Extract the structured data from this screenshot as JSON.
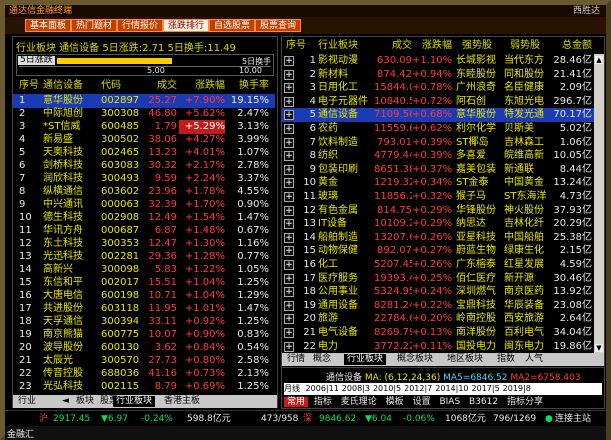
{
  "title_bar": {
    "left": "通达信金融终端",
    "right": "西胜达"
  },
  "toolbar": {
    "tabs": [
      "基本面板",
      "热门题材",
      "行情报价",
      "涨跌排行",
      "自选股票",
      "股票查询"
    ],
    "active": 3
  },
  "left_header": {
    "line": "行业板块  通信设备  5日涨跌:2.71  5日换手:11.49",
    "tab": "5日涨跌",
    "axis_left": "5.00",
    "axis_right": "10.00",
    "note": "5日换手"
  },
  "left_table": {
    "columns": [
      "序号",
      "通信设备",
      "代码",
      "成交",
      "涨跌幅",
      "换手率"
    ],
    "rows": [
      [
        "1",
        "意华股份",
        "002897",
        "25.27",
        "+7.90%",
        "19.15%"
      ],
      [
        "2",
        "中际旭创",
        "300308",
        "46.80",
        "+5.62%",
        "2.47%"
      ],
      [
        "3",
        "*ST信威",
        "600485",
        "1.79",
        "+5.29%",
        "3.13%"
      ],
      [
        "4",
        "新易盛",
        "300502",
        "38.06",
        "+4.27%",
        "3.99%"
      ],
      [
        "5",
        "天奥科技",
        "002465",
        "13.23",
        "+4.01%",
        "1.07%"
      ],
      [
        "6",
        "剑桥科技",
        "603083",
        "30.32",
        "+2.17%",
        "2.78%"
      ],
      [
        "7",
        "润欣科技",
        "300493",
        "9.59",
        "+2.24%",
        "3.37%"
      ],
      [
        "8",
        "纵横通信",
        "603602",
        "23.96",
        "+1.78%",
        "4.55%"
      ],
      [
        "9",
        "中兴通讯",
        "000063",
        "32.39",
        "+1.70%",
        "0.90%"
      ],
      [
        "10",
        "德生科技",
        "002908",
        "12.49",
        "+1.54%",
        "1.47%"
      ],
      [
        "11",
        "华讯方舟",
        "000687",
        "6.87",
        "+1.48%",
        "0.67%"
      ],
      [
        "12",
        "东土科技",
        "300353",
        "12.47",
        "+1.30%",
        "1.16%"
      ],
      [
        "13",
        "光迅科技",
        "002281",
        "29.36",
        "+1.28%",
        "0.77%"
      ],
      [
        "14",
        "高新兴",
        "300098",
        "5.83",
        "+1.22%",
        "1.05%"
      ],
      [
        "15",
        "东信和平",
        "002017",
        "15.51",
        "+1.04%",
        "1.25%"
      ],
      [
        "16",
        "大唐电信",
        "600198",
        "10.71",
        "+1.04%",
        "1.29%"
      ],
      [
        "17",
        "共进股份",
        "603118",
        "11.95",
        "+1.01%",
        "1.47%"
      ],
      [
        "18",
        "天孚通信",
        "300394",
        "33.11",
        "+0.92%",
        "1.25%"
      ],
      [
        "19",
        "南京熊猫",
        "600775",
        "10.07",
        "+0.90%",
        "0.83%"
      ],
      [
        "20",
        "波导股份",
        "600130",
        "3.62",
        "+0.84%",
        "0.54%"
      ],
      [
        "21",
        "太辰光",
        "300570",
        "27.73",
        "+0.80%",
        "2.58%"
      ],
      [
        "22",
        "传音控股",
        "688036",
        "41.16",
        "+0.73%",
        "2.13%"
      ],
      [
        "23",
        "光弘科技",
        "002115",
        "8.79",
        "+0.69%",
        "1.25%"
      ]
    ]
  },
  "left_tabs": [
    "行业",
    "板块",
    "股票",
    "行业板块",
    "香港主板"
  ],
  "left_tabs_active": 3,
  "right_table": {
    "columns": [
      "序号",
      "行业板块",
      "成交",
      "涨跌幅",
      "强势股",
      "弱势股",
      "总金额"
    ],
    "rows": [
      [
        "1",
        "影视动漫",
        "630.09",
        "+1.10%",
        "长城影视",
        "当代东方",
        "28.46亿"
      ],
      [
        "2",
        "新材料",
        "874.42",
        "+0.94%",
        "东睦股份",
        "同和股份",
        "21.41亿"
      ],
      [
        "3",
        "日用化工",
        "15844.07",
        "+0.78%",
        "广州浪奇",
        "名臣健康",
        "2.09亿"
      ],
      [
        "4",
        "电子元器件",
        "10840.54",
        "+0.72%",
        "阿石创",
        "东旭光电",
        "296.7亿"
      ],
      [
        "5",
        "通信设备",
        "7109.56",
        "+0.68%",
        "意华股份",
        "特发光通",
        "70.17亿"
      ],
      [
        "6",
        "农药",
        "11559.61",
        "+0.62%",
        "利尔化学",
        "贝斯美",
        "5.02亿"
      ],
      [
        "7",
        "饮料制造",
        "793.01",
        "+0.39%",
        "ST椰岛",
        "吉林森工",
        "1.06亿"
      ],
      [
        "8",
        "纺织",
        "4779.44",
        "+0.39%",
        "多喜爱",
        "皖维高新",
        "10.05亿"
      ],
      [
        "9",
        "包装印刷",
        "8651.38",
        "+0.37%",
        "嘉美包装",
        "新通联",
        "8.44亿"
      ],
      [
        "10",
        "黄金",
        "1219.32",
        "+0.34%",
        "ST金泰",
        "中国黄金",
        "13.24亿"
      ],
      [
        "11",
        "玻璃",
        "11856.23",
        "+0.32%",
        "猴子马",
        "ST东海洋",
        "4.73亿"
      ],
      [
        "12",
        "有色金属",
        "814.75",
        "+0.29%",
        "华锋股份",
        "神火股份",
        "37.93亿"
      ],
      [
        "13",
        "IT设备",
        "10109.20",
        "+0.29%",
        "纳思达",
        "吉林化纤",
        "20.29亿"
      ],
      [
        "14",
        "船舶制造",
        "13207.63",
        "+0.26%",
        "亚星科技",
        "中国船舶",
        "25.38亿"
      ],
      [
        "15",
        "动物保健",
        "892.07",
        "+0.27%",
        "蔚蓝生物",
        "绿康生化",
        "2.15亿"
      ],
      [
        "16",
        "化工",
        "5207.45",
        "+0.26%",
        "广东榕泰",
        "红星发展",
        "4.59亿"
      ],
      [
        "17",
        "医疗服务",
        "19393.44",
        "+0.25%",
        "佰仁医疗",
        "新开源",
        "30.46亿"
      ],
      [
        "18",
        "公用事业",
        "5324.95",
        "+0.24%",
        "深圳燃气",
        "南京医药",
        "13.92亿"
      ],
      [
        "19",
        "通用设备",
        "8281.24",
        "+0.22%",
        "宝鼎科技",
        "华辰装备",
        "23.08亿"
      ],
      [
        "20",
        "旅游",
        "22784.69",
        "+0.20%",
        "岭南控股",
        "西安旅游",
        "2.64亿"
      ],
      [
        "21",
        "电气设备",
        "8269.79",
        "+0.13%",
        "南洋股份",
        "百利电气",
        "34.04亿"
      ],
      [
        "22",
        "电力",
        "3772.22",
        "+0.11%",
        "国投电力",
        "闽东电力",
        "19.86亿"
      ]
    ]
  },
  "right_tabs": [
    "行情",
    "概念",
    "行业板块",
    "概念板块",
    "地区板块",
    "指数",
    "人气"
  ],
  "right_tabs_active": 2,
  "chart_strip": {
    "name": "通信设备",
    "ma_label": "MA: (6,12,24,36)",
    "ma5": "MA5=6846.52",
    "ma2": "MA2=6758.403",
    "dates": [
      "2006",
      "11",
      "2008",
      "3",
      "2010",
      "5",
      "2012",
      "7",
      "2014",
      "10",
      "2017",
      "5",
      "2019",
      "8"
    ],
    "period_label": "月线",
    "buttons": [
      "常用",
      "指标",
      "麦氏理论",
      "模板",
      "设置",
      "BIAS",
      "B3612",
      "指标分享"
    ]
  },
  "status_bar": {
    "sh_label": "沪",
    "sh_value": "2917.45",
    "sh_change": "▼6.97",
    "sh_pct": "-0.24%",
    "sh_amount": "598.8亿元",
    "mid": "473/958",
    "sz_label": "深",
    "sz_value": "9846.62",
    "sz_change": "▼6.04",
    "sz_pct": "-0.06%",
    "sz_amount": "1068亿元",
    "cnt": "796/1269",
    "conn": "连接主站",
    "brand": "金融汇"
  }
}
